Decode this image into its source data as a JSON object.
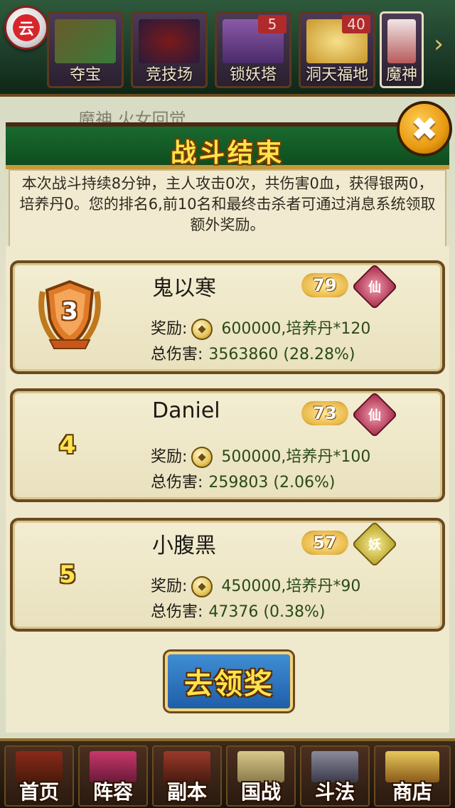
{
  "top_tabs": [
    {
      "label": "夺宝",
      "badge": ""
    },
    {
      "label": "竞技场",
      "badge": ""
    },
    {
      "label": "锁妖塔",
      "badge": "5"
    },
    {
      "label": "洞天福地",
      "badge": "40"
    },
    {
      "label": "魔神",
      "badge": ""
    }
  ],
  "cloud_button_glyph": "云",
  "behind_title": "魔神 火女回觉",
  "dialog": {
    "title": "战斗结束",
    "close_glyph": "✖",
    "summary": "本次战斗持续8分钟，主人攻击0次，共伤害0血，获得银两0，培养丹0。您的排名6,前10名和最终击杀者可通过消息系统领取额外奖励。"
  },
  "players": [
    {
      "rank": "3",
      "name": "鬼以寒",
      "level": "79",
      "faction": "仙",
      "reward_label": "奖励:",
      "reward": "600000,培养丹*120",
      "damage_label": "总伤害:",
      "damage": "3563860 (28.28%)"
    },
    {
      "rank": "4",
      "name": "Daniel",
      "level": "73",
      "faction": "仙",
      "reward_label": "奖励:",
      "reward": "500000,培养丹*100",
      "damage_label": "总伤害:",
      "damage": "259803 (2.06%)"
    },
    {
      "rank": "5",
      "name": "小腹黑",
      "level": "57",
      "faction": "妖",
      "reward_label": "奖励:",
      "reward": "450000,培养丹*90",
      "damage_label": "总伤害:",
      "damage": "47376 (0.38%)"
    }
  ],
  "claim_button": "去领奖",
  "bottom_nav": [
    {
      "label": "首页"
    },
    {
      "label": "阵容"
    },
    {
      "label": "副本"
    },
    {
      "label": "国战"
    },
    {
      "label": "斗法"
    },
    {
      "label": "商店"
    }
  ],
  "colors": {
    "title_gold": "#ffe34a",
    "header_green": "#1a6a2f",
    "card_frame": "#6b4a1f",
    "button_blue": "#1f5ea8"
  }
}
